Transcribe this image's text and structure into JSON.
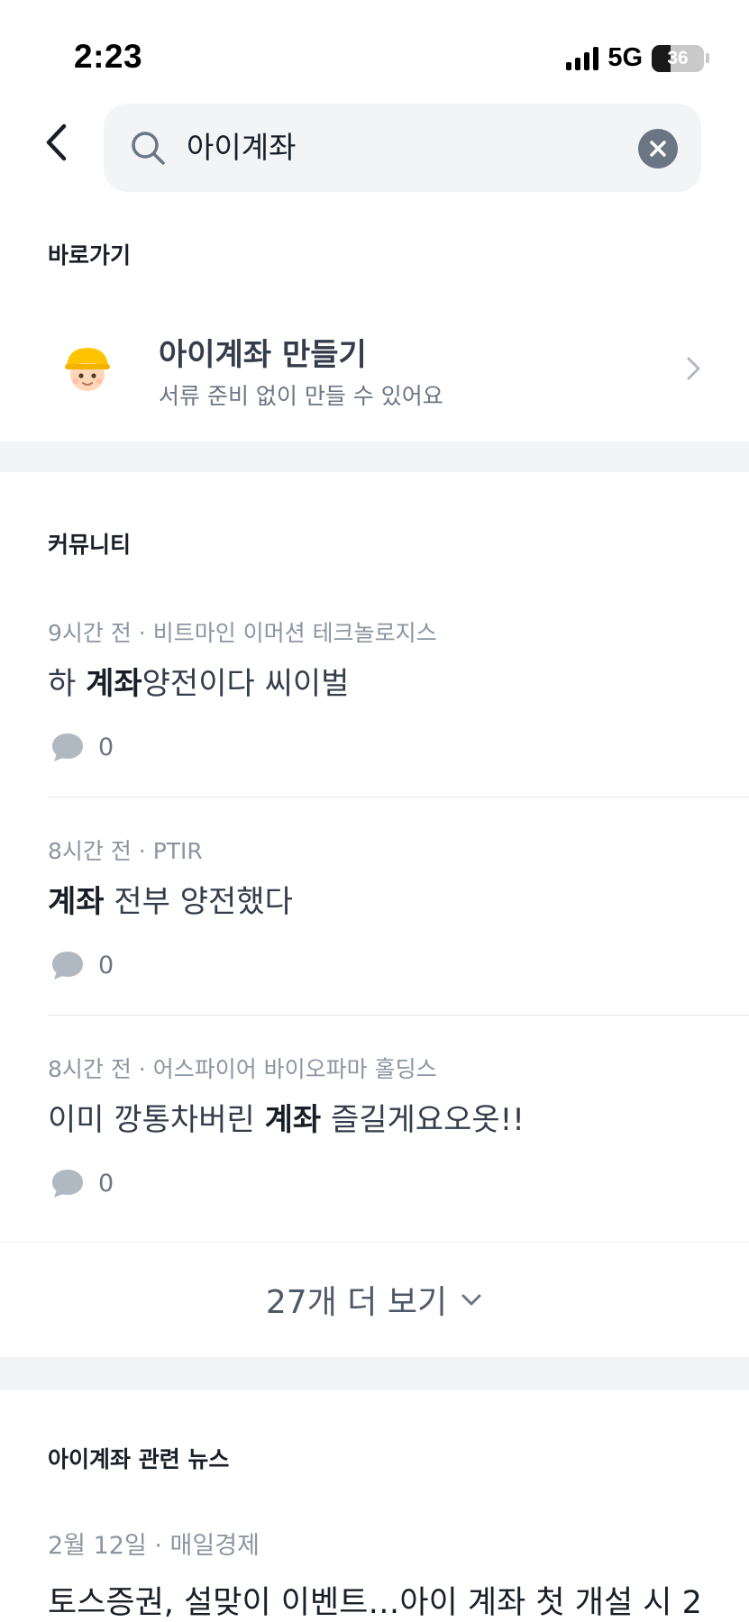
{
  "status_bar": {
    "time": "2:23",
    "network": "5G",
    "battery": "36",
    "battery_level_percent": 36
  },
  "search": {
    "value": "아이계좌",
    "icons": {
      "back": "chevron-left-icon",
      "search": "search-icon",
      "clear": "clear-circle-icon"
    }
  },
  "shortcuts": {
    "section_title": "바로가기",
    "item": {
      "title": "아이계좌 만들기",
      "subtitle": "서류 준비 없이 만들 수 있어요",
      "icon": "child-avatar-icon"
    }
  },
  "community": {
    "section_title": "커뮤니티",
    "posts": [
      {
        "meta": "9시간 전 · 비트마인 이머션 테크놀로지스",
        "title_pre": "하 ",
        "title_bold": "계좌",
        "title_post": "양전이다 씨이벌",
        "comments": "0"
      },
      {
        "meta": "8시간 전 · PTIR",
        "title_pre": "",
        "title_bold": "계좌",
        "title_post": " 전부 양전했다",
        "comments": "0"
      },
      {
        "meta": "8시간 전 · 어스파이어 바이오파마 홀딩스",
        "title_pre": "이미 깡통차버린 ",
        "title_bold": "계좌",
        "title_post": " 즐길게요오옷!!",
        "comments": "0"
      }
    ],
    "more_label": "27개 더 보기"
  },
  "news": {
    "section_title": "아이계좌 관련 뉴스",
    "items": [
      {
        "meta": "2월 12일 · 매일경제",
        "title": "토스증권, 설맞이 이벤트…아이 계좌 첫 개설 시 2"
      }
    ]
  },
  "colors": {
    "background": "#ffffff",
    "band": "#f2f4f6",
    "text_primary": "#191f28",
    "text_secondary": "#6b7684",
    "text_meta": "#8b95a1",
    "comment_icon": "#b0b8c1"
  }
}
